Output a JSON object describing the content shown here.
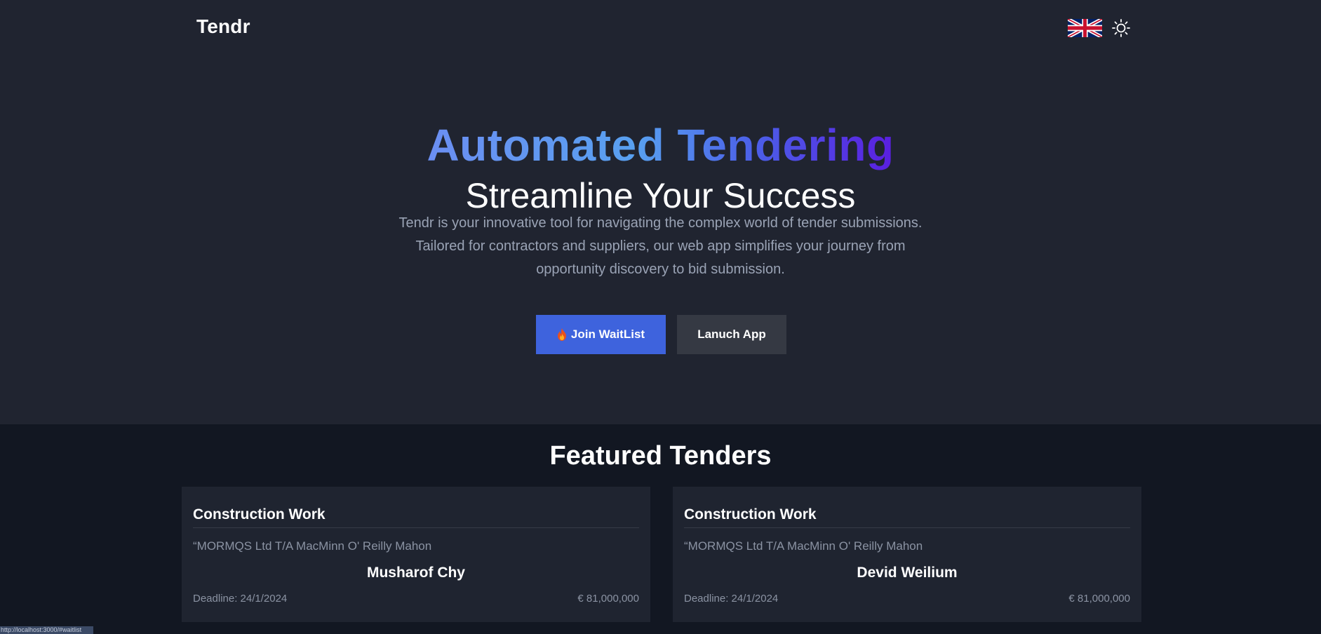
{
  "header": {
    "logo": "Tendr",
    "language_icon": "uk-flag-icon",
    "theme_icon": "sun-icon"
  },
  "hero": {
    "title": "Automated Tendering",
    "subtitle": "Streamline Your Success",
    "description": "Tendr is your innovative tool for navigating the complex world of tender submissions. Tailored for contractors and suppliers, our web app simplifies your journey from opportunity discovery to bid submission.",
    "join_button": "Join WaitList",
    "launch_button": "Lanuch App"
  },
  "featured": {
    "title": "Featured Tenders",
    "cards": [
      {
        "category": "Construction Work",
        "organization": "“MORMQS Ltd T/A MacMinn O' Reilly Mahon",
        "person": "Musharof Chy",
        "deadline": "Deadline: 24/1/2024",
        "amount": "€ 81,000,000"
      },
      {
        "category": "Construction Work",
        "organization": "“MORMQS Ltd T/A MacMinn O' Reilly Mahon",
        "person": "Devid Weilium",
        "deadline": "Deadline: 24/1/2024",
        "amount": "€ 81,000,000"
      }
    ]
  },
  "status_bar": {
    "url": "http://localhost:3000/#waitlist"
  },
  "colors": {
    "background": "#202430",
    "featured_background": "#121722",
    "primary_button": "#3e63dd",
    "secondary_button": "#353943",
    "muted_text": "#9aa3b5"
  }
}
